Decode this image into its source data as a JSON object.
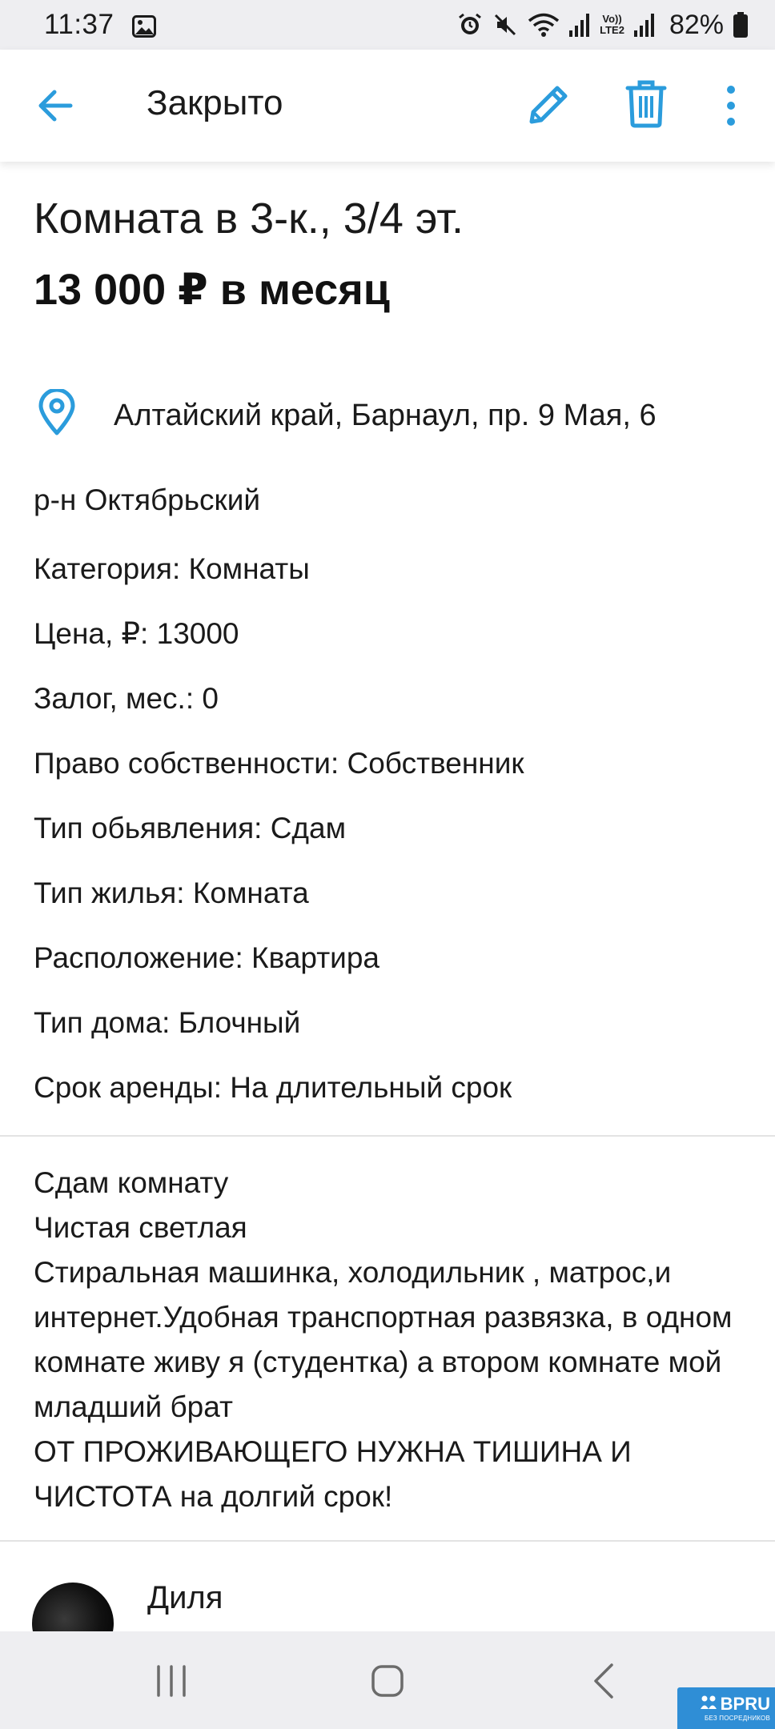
{
  "status_bar": {
    "time": "11:37",
    "battery": "82%",
    "network_label": "LTE2",
    "volte_label": "Vo))",
    "icons": [
      "gallery-icon",
      "alarm-icon",
      "mute-icon",
      "wifi-icon",
      "signal-icon",
      "signal-icon",
      "battery-icon"
    ]
  },
  "app_bar": {
    "title": "Закрыто",
    "icons": [
      "back-arrow-icon",
      "pencil-icon",
      "trash-icon",
      "more-vertical-icon"
    ],
    "accent_color": "#2b9cdc"
  },
  "listing": {
    "title": "Комната в 3-к., 3/4 эт.",
    "price": "13 000 ₽ в месяц",
    "address": "Алтайский край, Барнаул, пр. 9 Мая, 6",
    "district": "р-н Октябрьский",
    "properties": [
      "Категория: Комнаты",
      "Цена, ₽: 13000",
      "Залог, мес.: 0",
      "Право собственности: Собственник",
      "Тип обьявления: Сдам",
      "Тип жилья: Комната",
      "Расположение: Квартира",
      "Тип дома: Блочный",
      "Срок аренды: На длительный срок"
    ],
    "description": "Сдам комнату\nЧистая светлая\nСтиральная машинка, холодильник , матрос,и интернет.Удобная транспортная развязка, в одном комнате живу я (студентка) а втором комнате мой младший брат\nОТ ПРОЖИВАЮЩЕГО НУЖНА ТИШИНА И ЧИСТОТА на долгий срок!"
  },
  "seller": {
    "name": "Диля"
  },
  "nav_bar": {
    "icons": [
      "recents-icon",
      "home-icon",
      "back-icon"
    ]
  },
  "watermark": {
    "brand": "BPRU",
    "subtitle": "БЕЗ ПОСРЕДНИКОВ"
  }
}
